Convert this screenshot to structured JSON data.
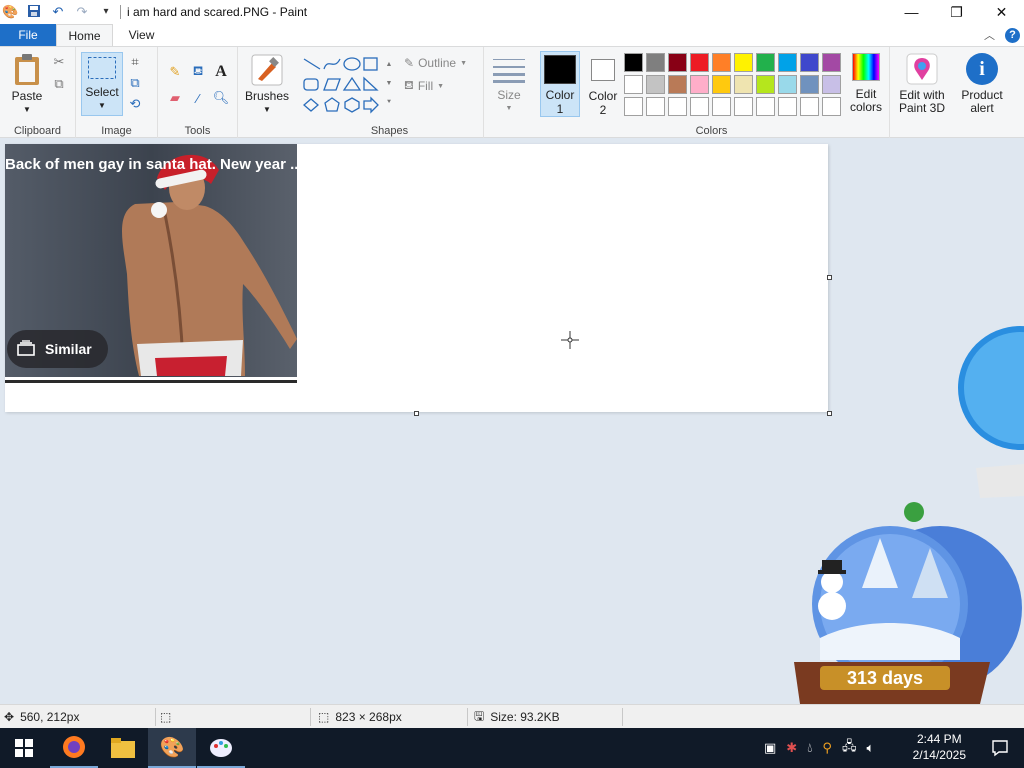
{
  "window": {
    "title": "i am hard and scared.PNG - Paint"
  },
  "menu": {
    "file": "File",
    "home": "Home",
    "view": "View"
  },
  "ribbon": {
    "clipboard": {
      "label": "Clipboard",
      "paste": "Paste"
    },
    "image": {
      "label": "Image",
      "select": "Select"
    },
    "tools": {
      "label": "Tools"
    },
    "brushes": {
      "label": "Brushes"
    },
    "shapes": {
      "label": "Shapes",
      "outline": "Outline",
      "fill": "Fill"
    },
    "size": {
      "label": "Size"
    },
    "color1": {
      "line1": "Color",
      "line2": "1",
      "value": "#000000"
    },
    "color2": {
      "line1": "Color",
      "line2": "2",
      "value": "#ffffff"
    },
    "colors_label": "Colors",
    "palette_row1": [
      "#000000",
      "#7f7f7f",
      "#880015",
      "#ed1c24",
      "#ff7f27",
      "#fff200",
      "#22b14c",
      "#00a2e8",
      "#3f48cc",
      "#a349a4"
    ],
    "palette_row2": [
      "#ffffff",
      "#c3c3c3",
      "#b97a57",
      "#ffaec9",
      "#ffc90e",
      "#efe4b0",
      "#b5e61d",
      "#99d9ea",
      "#7092be",
      "#c8bfe7"
    ],
    "palette_row3": [
      "#ffffff",
      "#ffffff",
      "#ffffff",
      "#ffffff",
      "#ffffff",
      "#ffffff",
      "#ffffff",
      "#ffffff",
      "#ffffff",
      "#ffffff"
    ],
    "edit_colors": {
      "line1": "Edit",
      "line2": "colors"
    },
    "paint3d": {
      "line1": "Edit with",
      "line2": "Paint 3D"
    },
    "product_alert": {
      "line1": "Product",
      "line2": "alert"
    }
  },
  "canvas": {
    "photo_caption": "Back of men gay in santa hat. New year ..",
    "similar_button": "Similar"
  },
  "desktop": {
    "countdown": "313 days"
  },
  "status": {
    "cursor_pos": "560, 212px",
    "dimensions": "823 × 268px",
    "size": "Size: 93.2KB"
  },
  "taskbar": {
    "time": "2:44 PM",
    "date": "2/14/2025"
  }
}
